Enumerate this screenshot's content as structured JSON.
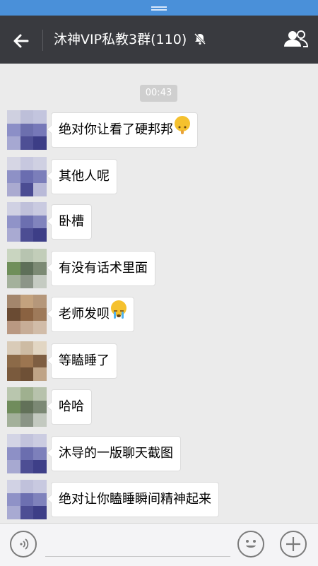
{
  "header": {
    "title": "沐神VIP私教3群(110)",
    "back_icon": "back-arrow-icon",
    "mute_icon": "bell-muted-icon",
    "members_icon": "group-members-icon"
  },
  "chat": {
    "timestamp": "00:43",
    "messages": [
      {
        "text": "绝对你让看了硬邦邦",
        "emoji": "shush-face-emoji"
      },
      {
        "text": "其他人呢"
      },
      {
        "text": "卧槽"
      },
      {
        "text": "有没有话术里面"
      },
      {
        "text": "老师发呗",
        "emoji": "crying-face-emoji"
      },
      {
        "text": "等瞌睡了"
      },
      {
        "text": "哈哈"
      },
      {
        "text": "沐导的一版聊天截图"
      },
      {
        "text": "绝对让你瞌睡瞬间精神起来"
      }
    ]
  },
  "input_bar": {
    "voice_icon": "voice-input-icon",
    "emoji_icon": "emoji-icon",
    "more_icon": "plus-icon"
  },
  "colors": {
    "status_bar": "#4a90d9",
    "title_bar": "#393a3f",
    "chat_bg": "#ebebeb",
    "bubble": "#ffffff"
  }
}
